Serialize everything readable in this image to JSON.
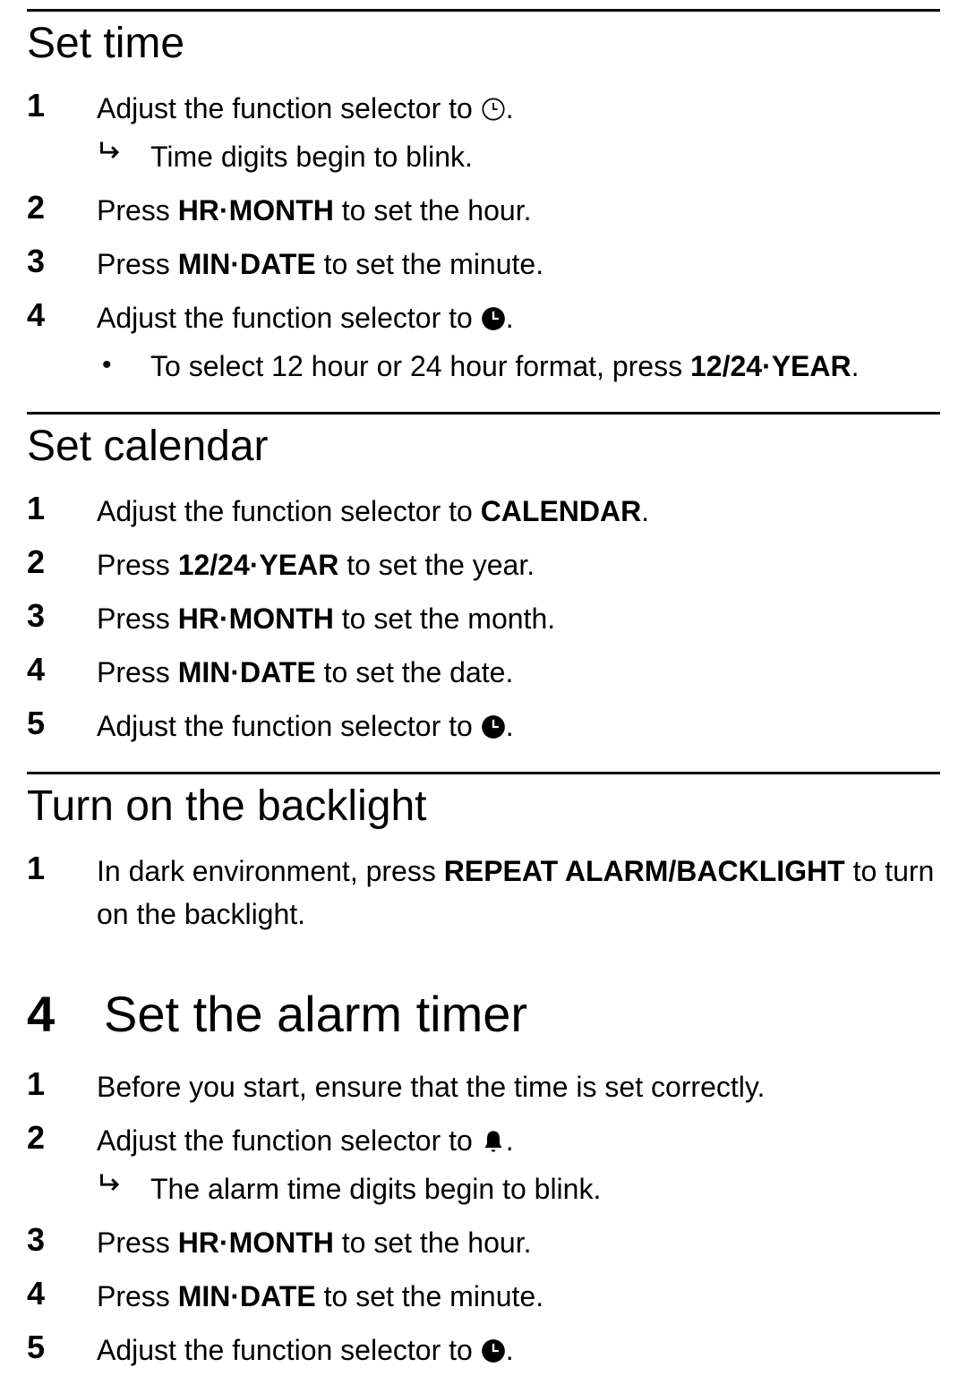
{
  "sections": {
    "set_time": {
      "heading": "Set time",
      "steps": [
        {
          "text_pre": "Adjust the function selector to ",
          "icon": "clock-outline",
          "text_post": ".",
          "sub_arrow": "Time digits begin to blink."
        },
        {
          "text_pre": "Press ",
          "bold": "HR·MONTH",
          "text_post": " to set the hour."
        },
        {
          "text_pre": "Press ",
          "bold": "MIN·DATE",
          "text_post": " to set the minute."
        },
        {
          "text_pre": "Adjust the function selector to ",
          "icon": "clock-solid",
          "text_post": ".",
          "sub_bullet_pre": "To select 12 hour or 24 hour format, press ",
          "sub_bullet_bold": "12/24·YEAR",
          "sub_bullet_post": "."
        }
      ]
    },
    "set_calendar": {
      "heading": "Set calendar",
      "steps": [
        {
          "text_pre": "Adjust the function selector to ",
          "bold": "CALENDAR",
          "text_post": "."
        },
        {
          "text_pre": "Press ",
          "bold": "12/24·YEAR",
          "text_post": " to set the year."
        },
        {
          "text_pre": "Press ",
          "bold": "HR·MONTH",
          "text_post": " to set the month."
        },
        {
          "text_pre": "Press ",
          "bold": "MIN·DATE",
          "text_post": " to set the date."
        },
        {
          "text_pre": "Adjust the function selector to ",
          "icon": "clock-solid",
          "text_post": "."
        }
      ]
    },
    "backlight": {
      "heading": "Turn on the backlight",
      "steps": [
        {
          "text_pre": "In dark environment, press ",
          "bold": "REPEAT ALARM/BACKLIGHT",
          "text_post": " to turn on the backlight."
        }
      ]
    },
    "chapter": {
      "number": "4",
      "title": "Set the alarm timer",
      "steps": [
        {
          "text_pre": "Before you start, ensure that the time is set correctly."
        },
        {
          "text_pre": "Adjust the function selector to ",
          "icon": "bell",
          "text_post": ".",
          "sub_arrow": "The alarm time digits begin to blink."
        },
        {
          "text_pre": "Press ",
          "bold": "HR·MONTH",
          "text_post": " to set the hour."
        },
        {
          "text_pre": "Press ",
          "bold": "MIN·DATE",
          "text_post": " to set the minute."
        },
        {
          "text_pre": "Adjust the function selector to ",
          "icon": "clock-solid",
          "text_post": "."
        }
      ]
    }
  }
}
